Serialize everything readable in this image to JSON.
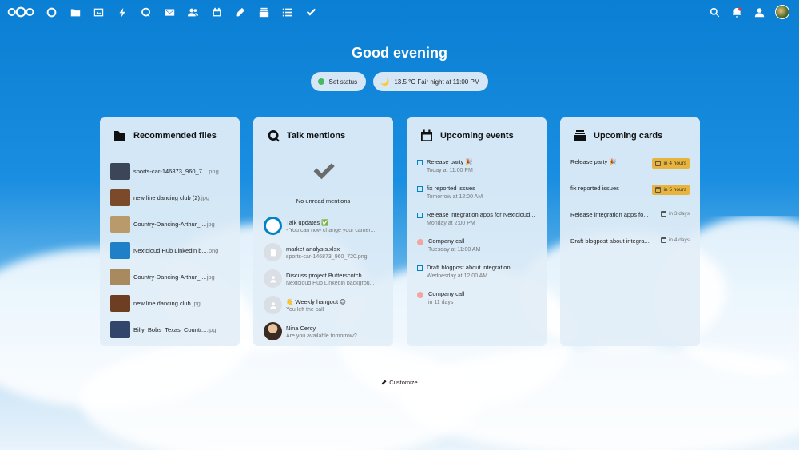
{
  "greeting": "Good evening",
  "status": {
    "set_status_label": "Set status",
    "weather_label": "13.5 °C Fair night at 11:00 PM"
  },
  "panels": {
    "recommended": {
      "title": "Recommended files",
      "files": [
        {
          "name": "sports-car-146873_960_7...",
          "ext": ".png",
          "thumb_color": "#3b4658"
        },
        {
          "name": "new line dancing club (2)",
          "ext": ".jpg",
          "thumb_color": "#7a4a2a"
        },
        {
          "name": "Country-Dancing-Arthur_...",
          "ext": ".jpg",
          "thumb_color": "#b99a6b"
        },
        {
          "name": "Nextcloud Hub Linkedin b...",
          "ext": ".png",
          "thumb_color": "#1f7fc7"
        },
        {
          "name": "Country-Dancing-Arthur_...",
          "ext": ".jpg",
          "thumb_color": "#a88a5e"
        },
        {
          "name": "new line dancing club",
          "ext": ".jpg",
          "thumb_color": "#6e3e22"
        },
        {
          "name": "Billy_Bobs_Texas_Countr...",
          "ext": ".jpg",
          "thumb_color": "#31466a"
        }
      ]
    },
    "talk": {
      "title": "Talk mentions",
      "no_mentions": "No unread mentions",
      "items": [
        {
          "title": "Talk updates ✅",
          "sub": "- You can now change your camer...",
          "avatar": "talk"
        },
        {
          "title": "market analysis.xlsx",
          "sub": "sports-car-146873_960_720.png",
          "avatar": "file"
        },
        {
          "title": "Discuss project Butterscotch",
          "sub": "Nextcloud Hub Linkedin backgrou...",
          "avatar": "group"
        },
        {
          "title": "👋 Weekly hangout 😍",
          "sub": "You left the call",
          "avatar": "group"
        },
        {
          "title": "Nina Cercy",
          "sub": "Are you available tomorrow?",
          "avatar": "photo"
        }
      ]
    },
    "events": {
      "title": "Upcoming events",
      "items": [
        {
          "title": "Release party 🎉",
          "sub": "Today at 11:00 PM",
          "kind": "task"
        },
        {
          "title": "fix reported issues",
          "sub": "Tomorrow at 12:00 AM",
          "kind": "task"
        },
        {
          "title": "Release integration apps for Nextcloud...",
          "sub": "Monday at 2:00 PM",
          "kind": "task"
        },
        {
          "title": "Company call",
          "sub": "Tuesday at 11:00 AM",
          "kind": "event"
        },
        {
          "title": "Draft blogpost about integration",
          "sub": "Wednesday at 12:00 AM",
          "kind": "task"
        },
        {
          "title": "Company call",
          "sub": "in 11 days",
          "kind": "event"
        }
      ]
    },
    "cards": {
      "title": "Upcoming cards",
      "items": [
        {
          "title": "Release party 🎉",
          "due": "in 4 hours",
          "urgent": true
        },
        {
          "title": "fix reported issues",
          "due": "in 5 hours",
          "urgent": true
        },
        {
          "title": "Release integration apps fo...",
          "due": "in 3 days",
          "urgent": false
        },
        {
          "title": "Draft blogpost about integra...",
          "due": "in 4 days",
          "urgent": false
        }
      ]
    }
  },
  "customize_label": "Customize",
  "colors": {
    "brand": "#0082c9",
    "status_online": "#46ba61",
    "due_badge": "#e9b43c"
  },
  "header_icons": [
    "dashboard-icon",
    "files-icon",
    "photos-icon",
    "activity-icon",
    "talk-icon",
    "mail-icon",
    "contacts-icon",
    "calendar-icon",
    "notes-icon",
    "deck-icon",
    "tasks-icon",
    "check-icon"
  ],
  "header_right_icons": [
    "search-icon",
    "notifications-icon",
    "contacts-menu-icon",
    "user-avatar"
  ]
}
